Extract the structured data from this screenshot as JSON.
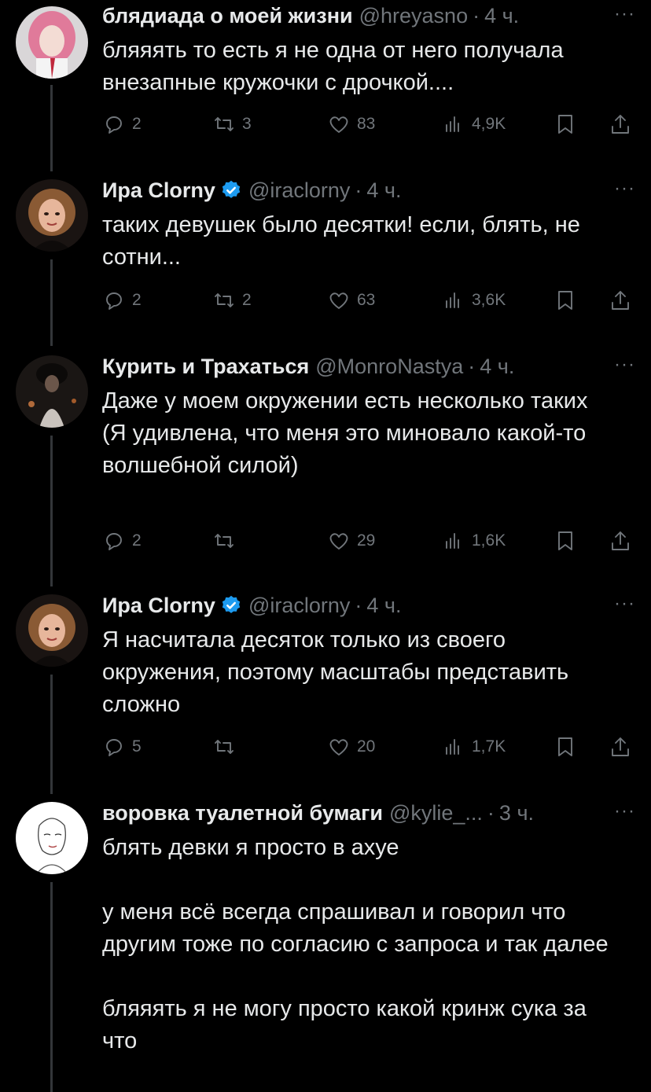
{
  "tweets": [
    {
      "name": "блядиада о моей жизни",
      "verified": false,
      "handle": "@hreyasno",
      "time": "4 ч.",
      "text": "бляяять то есть я не одна от него получала внезапные кружочки с дрочкой....",
      "replies": "2",
      "retweets": "3",
      "likes": "83",
      "views": "4,9K",
      "avatar_icon": "avatar-pink-hair"
    },
    {
      "name": "Ира Clorny",
      "verified": true,
      "handle": "@iraclorny",
      "time": "4 ч.",
      "text": "таких девушек было десятки! если, блять, не сотни...",
      "replies": "2",
      "retweets": "2",
      "likes": "63",
      "views": "3,6K",
      "avatar_icon": "avatar-illustrated-woman"
    },
    {
      "name": "Курить и Трахаться",
      "verified": false,
      "handle": "@MonroNastya",
      "time": "4 ч.",
      "text": "Даже у моем окружении есть несколько таких\n(Я удивлена, что меня это миновало какой-то волшебной силой)",
      "replies": "2",
      "retweets": "",
      "likes": "29",
      "views": "1,6K",
      "avatar_icon": "avatar-dark-photo"
    },
    {
      "name": "Ира Clorny",
      "verified": true,
      "handle": "@iraclorny",
      "time": "4 ч.",
      "text": "Я насчитала десяток только из своего окружения, поэтому масштабы представить сложно",
      "replies": "5",
      "retweets": "",
      "likes": "20",
      "views": "1,7K",
      "avatar_icon": "avatar-illustrated-woman"
    },
    {
      "name": "воровка туалетной бумаги",
      "verified": false,
      "handle": "@kylie_...",
      "time": "3 ч.",
      "text": "блять девки я просто в ахуе\n\nу меня всё всегда спрашивал и говорил что другим тоже по согласию с запроса и так далее\n\nбляяять я не могу просто какой кринж сука за что",
      "avatar_icon": "avatar-line-drawing"
    }
  ],
  "more_label": "···",
  "dot_separator": "·",
  "colors": {
    "background": "#000000",
    "text": "#e7e9ea",
    "muted": "#71767b",
    "verified": "#1d9bf0",
    "thread_line": "#333639"
  }
}
